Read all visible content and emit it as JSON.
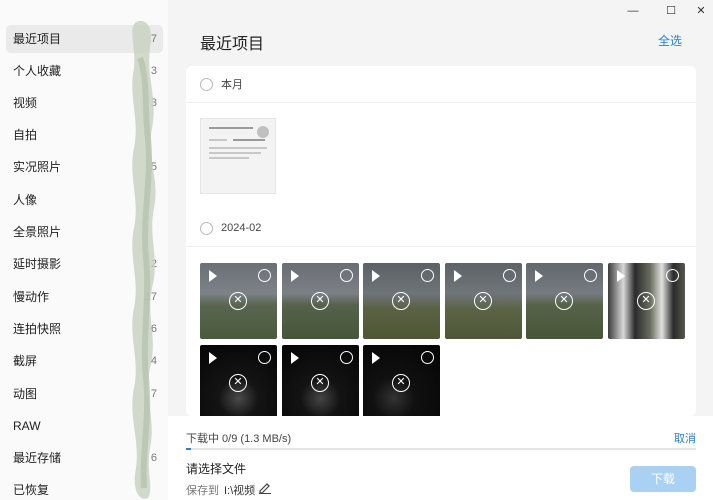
{
  "window": {
    "min_glyph": "—",
    "max_glyph": "☐",
    "close_glyph": "✕"
  },
  "sidebar": {
    "items": [
      {
        "label": "最近项目",
        "count": "7"
      },
      {
        "label": "个人收藏",
        "count": "3"
      },
      {
        "label": "视频",
        "count": "3"
      },
      {
        "label": "自拍",
        "count": ""
      },
      {
        "label": "实况照片",
        "count": "5"
      },
      {
        "label": "人像",
        "count": ""
      },
      {
        "label": "全景照片",
        "count": ""
      },
      {
        "label": "延时摄影",
        "count": "2"
      },
      {
        "label": "慢动作",
        "count": "17"
      },
      {
        "label": "连拍快照",
        "count": "6"
      },
      {
        "label": "截屏",
        "count": "4"
      },
      {
        "label": "动图",
        "count": "7"
      },
      {
        "label": "RAW",
        "count": ""
      },
      {
        "label": "最近存储",
        "count": "6"
      },
      {
        "label": "已恢复",
        "count": ""
      }
    ]
  },
  "main": {
    "title": "最近项目",
    "select_all": "全选",
    "sections": [
      {
        "label": "本月"
      },
      {
        "label": "2024-02"
      }
    ],
    "doc_thumb_caption": "OPPO手机照片如何导入电脑",
    "video_thumbs": [
      {
        "theme": "landscape"
      },
      {
        "theme": "landscape"
      },
      {
        "theme": "field"
      },
      {
        "theme": "field"
      },
      {
        "theme": "landscape"
      },
      {
        "theme": "people"
      },
      {
        "theme": "night"
      },
      {
        "theme": "night"
      },
      {
        "theme": "night"
      }
    ]
  },
  "download": {
    "status": "下载中 0/9 (1.3 MB/s)",
    "cancel": "取消",
    "progress": 0.01,
    "choose_file": "请选择文件",
    "save_to_label": "保存到",
    "save_path": "I:\\视频",
    "button": "下载"
  },
  "colors": {
    "accent": "#2a7fd4",
    "button_disabled": "#a9d1f3"
  }
}
